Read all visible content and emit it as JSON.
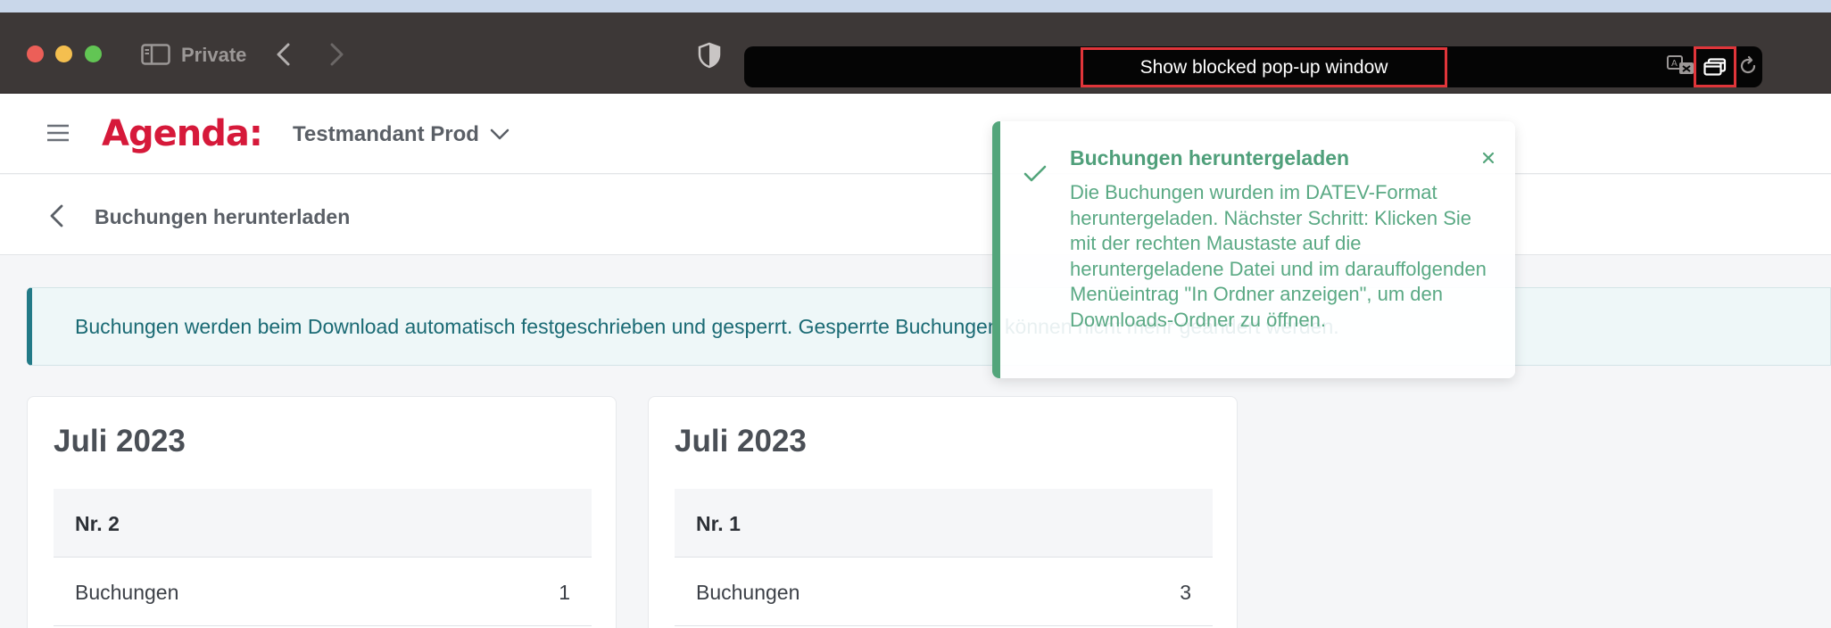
{
  "browser": {
    "mode_label": "Private",
    "popup_notice": "Show blocked pop-up window",
    "icons": [
      "sidebar-icon",
      "back-icon",
      "forward-icon",
      "shield-icon",
      "translate-icon",
      "popup-window-icon",
      "reload-icon"
    ]
  },
  "app": {
    "logo": "Agenda:",
    "tenant": "Testmandant Prod",
    "brand_color": "#d6193a"
  },
  "page": {
    "title": "Buchungen herunterladen"
  },
  "info_banner": {
    "text": "Buchungen werden beim Download automatisch festgeschrieben und gesperrt. Gesperrte Buchungen können nicht mehr geändert werden."
  },
  "cards": [
    {
      "month": "Juli 2023",
      "number": "Nr. 2",
      "row_label": "Buchungen",
      "row_value": "1"
    },
    {
      "month": "Juli 2023",
      "number": "Nr. 1",
      "row_label": "Buchungen",
      "row_value": "3"
    }
  ],
  "toast": {
    "title": "Buchungen heruntergeladen",
    "body": "Die Buchungen wurden im DATEV-Format heruntergeladen. Nächster Schritt: Klicken Sie mit der rechten Maustaste auf die heruntergeladene Datei und im darauffolgenden Menüeintrag \"In Ordner anzeigen\", um den Downloads-Ordner zu öffnen.",
    "accent": "#53a57b"
  }
}
